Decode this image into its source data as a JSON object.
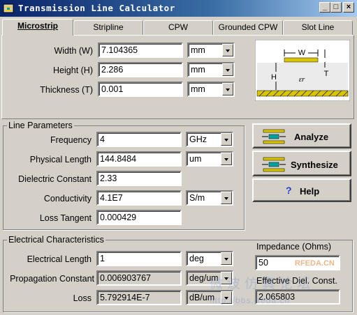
{
  "window": {
    "title": "Transmission Line Calculator",
    "buttons": {
      "minimize": "_",
      "maximize": "□",
      "close": "×"
    }
  },
  "tabs": [
    {
      "label": "Microstrip",
      "active": true
    },
    {
      "label": "Stripline",
      "active": false
    },
    {
      "label": "CPW",
      "active": false
    },
    {
      "label": "Grounded CPW",
      "active": false
    },
    {
      "label": "Slot Line",
      "active": false
    }
  ],
  "geometry": {
    "width": {
      "label": "Width (W)",
      "value": "7.104365",
      "unit": "mm"
    },
    "height": {
      "label": "Height (H)",
      "value": "2.286",
      "unit": "mm"
    },
    "thickness": {
      "label": "Thickness (T)",
      "value": "0.001",
      "unit": "mm"
    }
  },
  "diagram": {
    "w": "W",
    "t": "T",
    "h": "H",
    "er": "εr"
  },
  "line_parameters": {
    "title": "Line Parameters",
    "frequency": {
      "label": "Frequency",
      "value": "4",
      "unit": "GHz"
    },
    "physical_length": {
      "label": "Physical Length",
      "value": "144.8484",
      "unit": "um"
    },
    "dielectric_constant": {
      "label": "Dielectric Constant",
      "value": "2.33"
    },
    "conductivity": {
      "label": "Conductivity",
      "value": "4.1E7",
      "unit": "S/m"
    },
    "loss_tangent": {
      "label": "Loss Tangent",
      "value": "0.000429"
    }
  },
  "actions": {
    "analyze": "Analyze",
    "synthesize": "Synthesize",
    "help": "Help"
  },
  "electrical": {
    "title": "Electrical Characteristics",
    "electrical_length": {
      "label": "Electrical Length",
      "value": "1",
      "unit": "deg"
    },
    "propagation_constant": {
      "label": "Propagation Constant",
      "value": "0.006903767",
      "unit": "deg/um"
    },
    "loss": {
      "label": "Loss",
      "value": "5.792914E-7",
      "unit": "dB/um"
    },
    "impedance": {
      "label": "Impedance (Ohms)",
      "value": "50"
    },
    "eff_diel": {
      "label": "Effective Diel. Const.",
      "value": "2.065803"
    }
  },
  "watermark": {
    "site": "RFEDA.CN",
    "cn": "微波仿真论坛",
    "url": "http://bbs.rfeda.cn"
  }
}
